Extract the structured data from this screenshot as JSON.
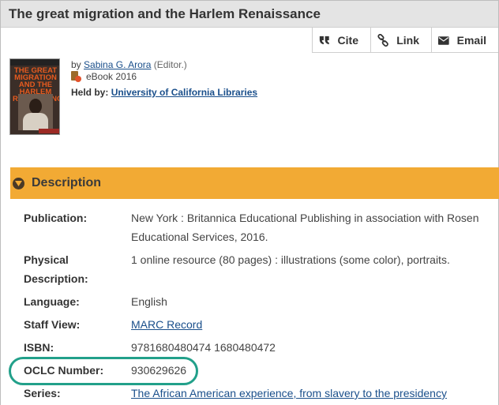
{
  "title": "The great migration and the Harlem Renaissance",
  "actions": {
    "cite_label": "Cite",
    "link_label": "Link",
    "email_label": "Email"
  },
  "cover": {
    "series_text": "EXPERIENCE",
    "title_text": "THE GREAT MIGRATION AND THE HARLEM RENAISSANCE",
    "publisher_text": "Britannica"
  },
  "item": {
    "by_prefix": "by",
    "author": "Sabina G. Arora",
    "role": "(Editor.)",
    "format": "eBook 2016",
    "held_by_label": "Held by:",
    "held_by_value": "University of California Libraries"
  },
  "description": {
    "header": "Description",
    "rows": [
      {
        "label": "Publication:",
        "value": "New York : Britannica Educational Publishing in association with Rosen Educational Services, 2016."
      },
      {
        "label": "Physical Description:",
        "value": "1 online resource (80 pages) : illustrations (some color), portraits."
      },
      {
        "label": "Language:",
        "value": "English"
      },
      {
        "label": "Staff View:",
        "value": "MARC Record"
      },
      {
        "label": "ISBN:",
        "value": "9781680480474 1680480472"
      },
      {
        "label": "OCLC Number:",
        "value": "930629626"
      },
      {
        "label": "Series:",
        "value": "The African American experience, from slavery to the presidency"
      }
    ]
  },
  "colors": {
    "description_bar": "#f2aa34",
    "highlight_outline": "#22a08a",
    "link": "#1a4f8b"
  }
}
